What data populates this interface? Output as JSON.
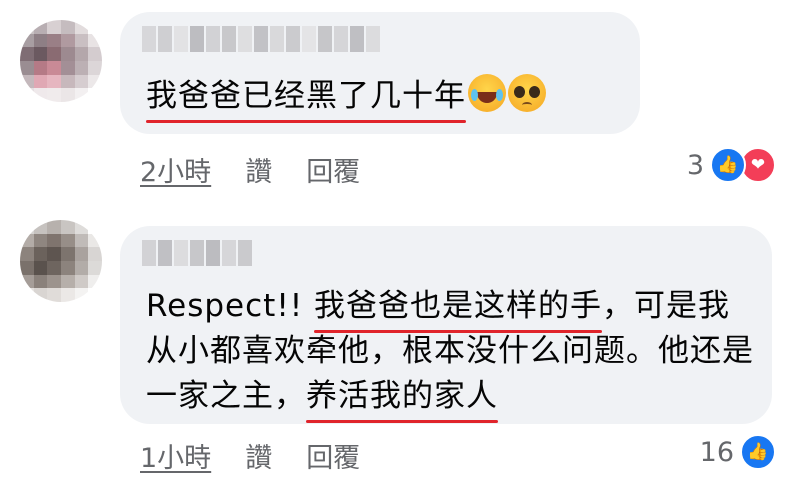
{
  "comments": [
    {
      "text_underlined": "我爸爸已经黑了几十年",
      "emojis": [
        "laughing-tears-emoji",
        "pleading-face-emoji"
      ],
      "time": "2小時",
      "like_label": "讚",
      "reply_label": "回覆",
      "reaction_count": "3",
      "reactions": [
        "like-icon",
        "love-icon"
      ]
    },
    {
      "text_prefix": "Respect!! ",
      "text_underlined_1": "我爸爸也是这样的手",
      "text_middle": "，可是我从小都喜欢牵他，根本没什么问题。他还是一家之主，",
      "text_underlined_2": "养活我的家人",
      "time": "1小時",
      "like_label": "讚",
      "reply_label": "回覆",
      "reaction_count": "16",
      "reactions": [
        "like-icon"
      ]
    }
  ],
  "colors": {
    "bubble": "#f0f2f5",
    "underline": "#e0242b",
    "meta_text": "#65676b",
    "like": "#1877f2",
    "love": "#f33e58"
  }
}
